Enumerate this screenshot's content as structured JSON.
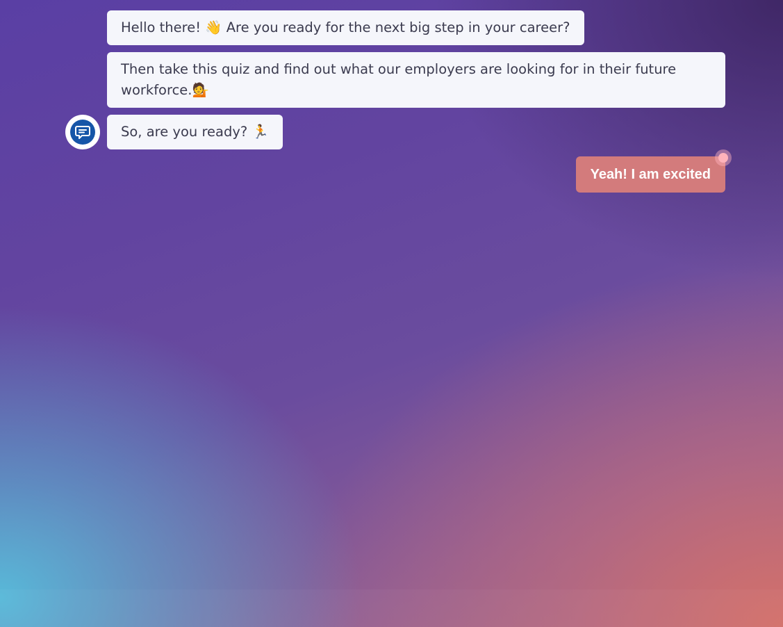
{
  "chat": {
    "messages": [
      {
        "text": "Hello there! 👋 Are you ready for the next big step in your career?"
      },
      {
        "text": "Then take this quiz and find out what our employers are looking for in their future workforce.💁"
      },
      {
        "text": "So, are you ready? 🏃"
      }
    ],
    "bot_avatar_icon": "chat-bubble-icon",
    "reply_button_label": "Yeah! I am excited"
  },
  "colors": {
    "bubble_background": "#f5f6fb",
    "reply_button": "#d37b7c",
    "avatar_brand": "#1656a8"
  }
}
